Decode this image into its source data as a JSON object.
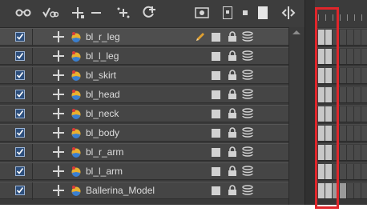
{
  "toolbar": {
    "icons": [
      "glasses-icon",
      "animate-mode-icon",
      "add-layer-icon",
      "remove-layer-icon",
      "add-peg-icon",
      "add-drawing-layer-icon",
      "onion-skin-icon",
      "show-hide-icon",
      "small-square-icon",
      "large-square-icon",
      "expand-timeline-icon"
    ]
  },
  "layers": [
    {
      "name": "bl_r_leg",
      "selected": true,
      "editing": true
    },
    {
      "name": "bl_l_leg"
    },
    {
      "name": "bl_skirt"
    },
    {
      "name": "bl_head"
    },
    {
      "name": "bl_neck"
    },
    {
      "name": "bl_body"
    },
    {
      "name": "bl_r_arm"
    },
    {
      "name": "bl_l_arm"
    },
    {
      "name": "Ballerina_Model"
    }
  ],
  "colors": {
    "panel": "#3a3a3a",
    "row": "#454545",
    "checkbox": "#2d4f7d",
    "highlight": "#e0262b",
    "pencil": "#e0a030"
  }
}
